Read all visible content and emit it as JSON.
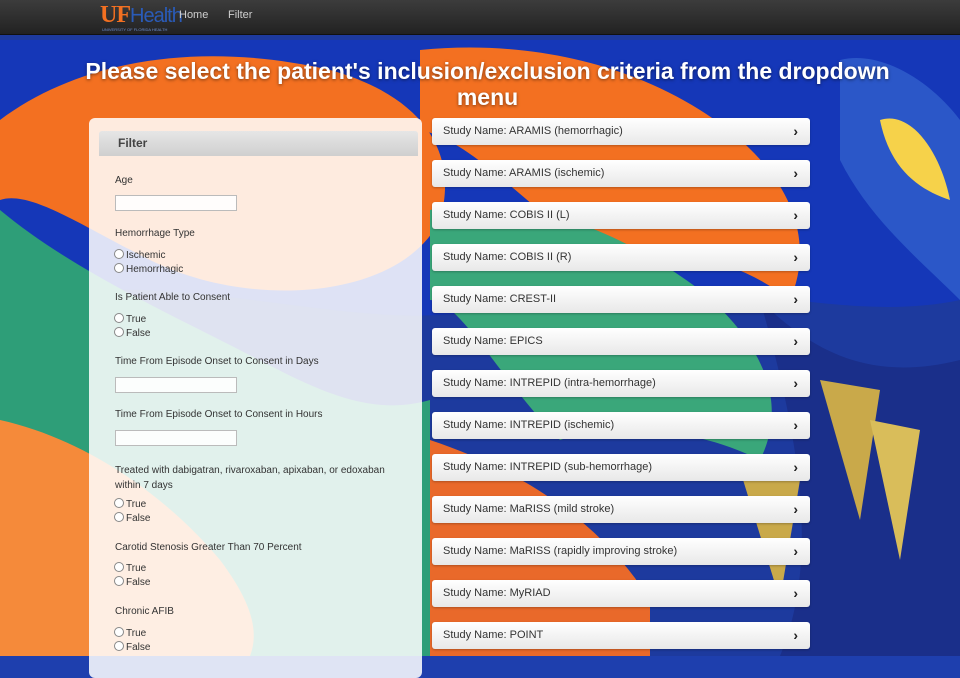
{
  "nav": {
    "logo_main": "UF",
    "logo_accent": "Health",
    "logo_sub": "UNIVERSITY OF FLORIDA HEALTH",
    "links": [
      "Home",
      "Filter"
    ]
  },
  "headline": "Please select the patient's inclusion/exclusion criteria from the dropdown menu",
  "filter": {
    "title": "Filter",
    "age_label": "Age",
    "hemorrhage_label": "Hemorrhage Type",
    "hemorrhage_options": [
      "Ischemic",
      "Hemorrhagic"
    ],
    "consent_label": "Is Patient Able to Consent",
    "consent_options": [
      "True",
      "False"
    ],
    "days_label": "Time From Episode Onset to Consent in Days",
    "hours_label": "Time From Episode Onset to Consent in Hours",
    "anticoag_label": "Treated with dabigatran, rivaroxaban, apixaban, or edoxaban within 7 days",
    "anticoag_options": [
      "True",
      "False"
    ],
    "carotid_label": "Carotid Stenosis Greater Than 70 Percent",
    "carotid_options": [
      "True",
      "False"
    ],
    "afib_label": "Chronic AFIB",
    "afib_options": [
      "True",
      "False"
    ]
  },
  "studies": [
    "Study Name: ARAMIS (hemorrhagic)",
    "Study Name: ARAMIS (ischemic)",
    "Study Name: COBIS II (L)",
    "Study Name: COBIS II (R)",
    "Study Name: CREST-II",
    "Study Name: EPICS",
    "Study Name: INTREPID (intra-hemorrhage)",
    "Study Name: INTREPID (ischemic)",
    "Study Name: INTREPID (sub-hemorrhage)",
    "Study Name: MaRISS (mild stroke)",
    "Study Name: MaRISS (rapidly improving stroke)",
    "Study Name: MyRIAD",
    "Study Name: POINT"
  ],
  "chevron_glyph": "›",
  "colors": {
    "orange": "#f37021",
    "blue": "#1e3fae",
    "green": "#3aa77a",
    "navbar": "#2a2a2a"
  }
}
